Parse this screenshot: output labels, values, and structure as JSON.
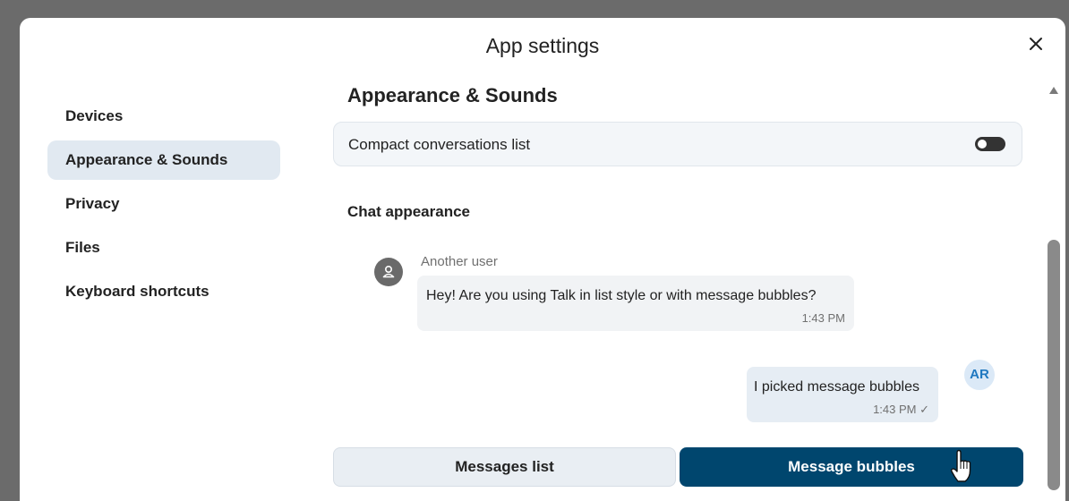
{
  "dialog": {
    "title": "App settings"
  },
  "sidebar": {
    "items": [
      {
        "label": "Devices",
        "active": false
      },
      {
        "label": "Appearance & Sounds",
        "active": true
      },
      {
        "label": "Privacy",
        "active": false
      },
      {
        "label": "Files",
        "active": false
      },
      {
        "label": "Keyboard shortcuts",
        "active": false
      }
    ]
  },
  "main": {
    "section_title": "Appearance & Sounds",
    "compact_list": {
      "label": "Compact conversations list",
      "enabled": false
    },
    "chat_appearance": {
      "title": "Chat appearance",
      "incoming": {
        "author": "Another user",
        "text": "Hey! Are you using Talk in list style or with message bubbles?",
        "time": "1:43 PM"
      },
      "outgoing": {
        "avatar_initials": "AR",
        "text": "I picked message bubbles",
        "time": "1:43 PM ✓"
      }
    },
    "style_buttons": {
      "list_label": "Messages list",
      "bubbles_label": "Message bubbles",
      "selected": "Message bubbles"
    }
  },
  "colors": {
    "accent": "#00466e",
    "active_nav": "#e1e9f1",
    "avatar_text": "#1f78c0"
  }
}
